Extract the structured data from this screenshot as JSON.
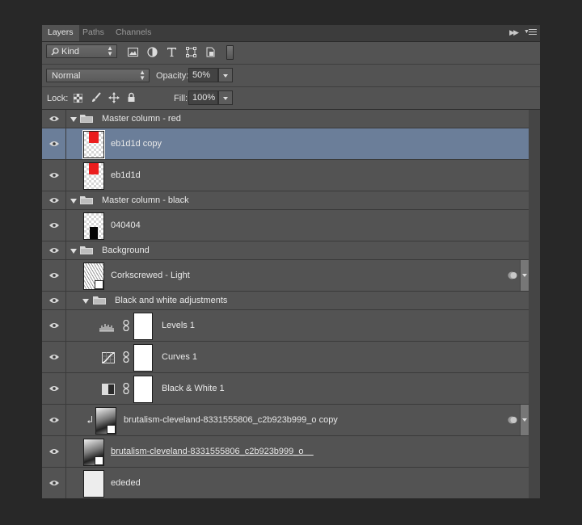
{
  "tabs": [
    {
      "label": "Layers",
      "active": true
    },
    {
      "label": "Paths",
      "active": false
    },
    {
      "label": "Channels",
      "active": false
    }
  ],
  "filter": {
    "kind_label": "Kind",
    "icons": [
      "image-filter-icon",
      "adjustment-filter-icon",
      "type-filter-icon",
      "shape-filter-icon",
      "smart-object-filter-icon",
      "filter-toggle-icon"
    ]
  },
  "blend": {
    "mode": "Normal",
    "opacity_label": "Opacity:",
    "opacity": "50%"
  },
  "lock": {
    "label": "Lock:",
    "fill_label": "Fill:",
    "fill": "100%"
  },
  "layers": [
    {
      "name": "Master column - red",
      "type": "group"
    },
    {
      "name": "eb1d1d copy",
      "type": "layer",
      "selected": true,
      "color": "#eb1d1d"
    },
    {
      "name": "eb1d1d",
      "type": "layer",
      "color": "#eb1d1d"
    },
    {
      "name": "Master column - black",
      "type": "group"
    },
    {
      "name": "040404",
      "type": "layer",
      "color": "#040404"
    },
    {
      "name": "Background",
      "type": "group"
    },
    {
      "name": "Corkscrewed - Light",
      "type": "smart"
    },
    {
      "name": "Black and white adjustments",
      "type": "group"
    },
    {
      "name": "Levels 1",
      "type": "adjustment",
      "icon": "levels-icon"
    },
    {
      "name": "Curves 1",
      "type": "adjustment",
      "icon": "curves-icon"
    },
    {
      "name": "Black & White 1",
      "type": "adjustment",
      "icon": "black-white-icon"
    },
    {
      "name": "brutalism-cleveland-8331555806_c2b923b999_o  copy",
      "type": "smart-clipped"
    },
    {
      "name": "brutalism-cleveland-8331555806_c2b923b999_o    ",
      "type": "smart-underlined"
    },
    {
      "name": "ededed",
      "type": "layer",
      "color": "#ededed"
    }
  ]
}
